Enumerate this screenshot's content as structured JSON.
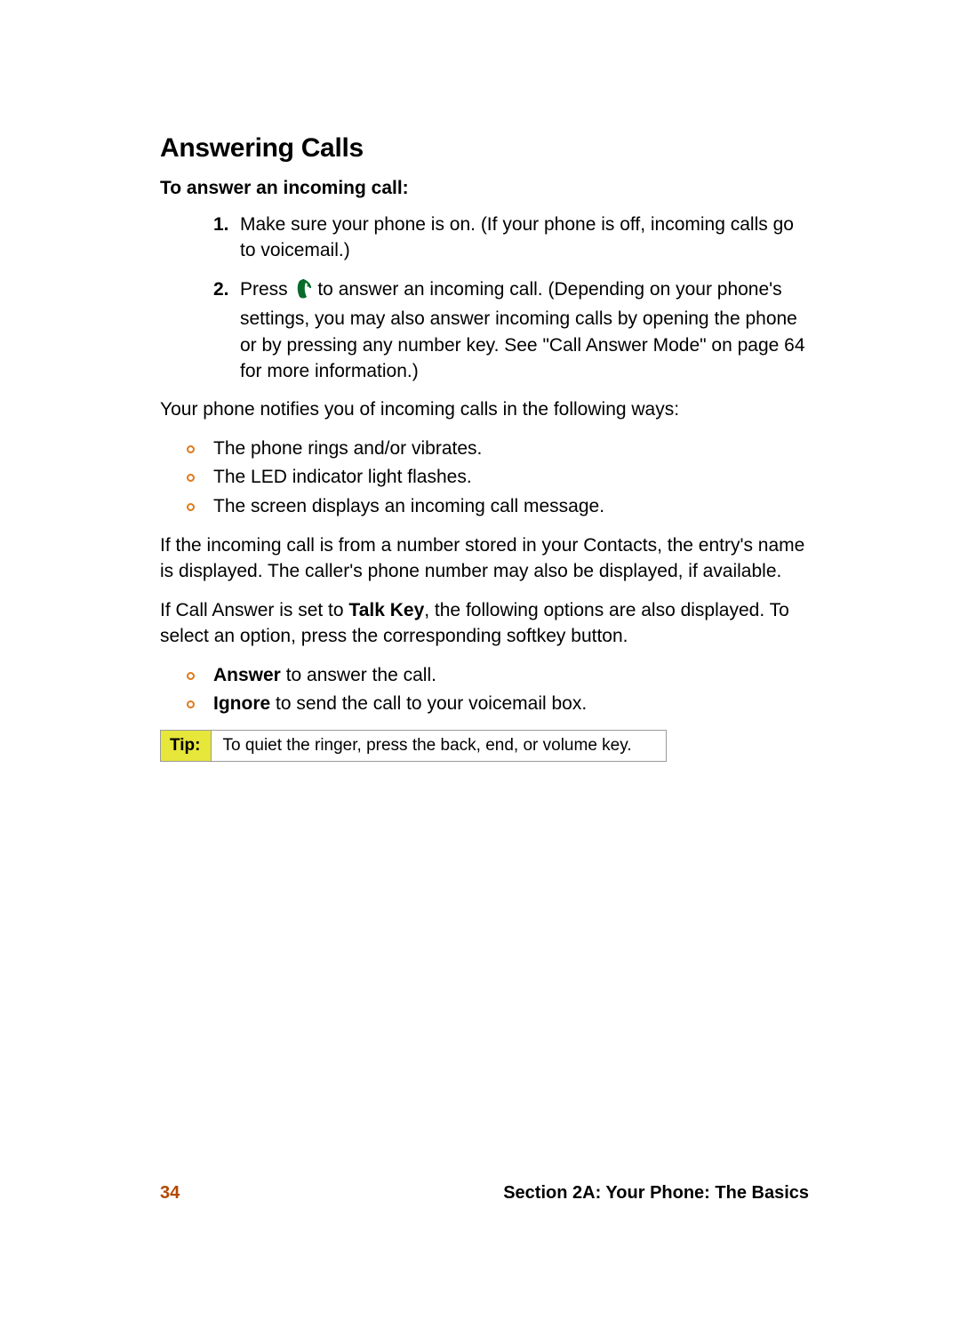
{
  "heading": "Answering Calls",
  "subheading": "To answer an incoming call:",
  "steps": [
    {
      "marker": "1.",
      "text": "Make sure your phone is on. (If your phone is off, incoming calls go to voicemail.)"
    },
    {
      "marker": "2.",
      "pre": "Press ",
      "post": " to answer an incoming call. (Depending on your phone's settings, you may also answer incoming calls by opening the phone or by pressing any number key. See \"Call Answer Mode\" on page 64 for more information.)"
    }
  ],
  "notify_intro": "Your phone notifies you of incoming calls in the following ways:",
  "notify_items": [
    "The phone rings and/or vibrates.",
    "The LED indicator light flashes.",
    "The screen displays an incoming call message."
  ],
  "contacts_para": "If the incoming call is from a number stored in your Contacts, the entry's name is displayed. The caller's phone number may also be displayed, if available.",
  "talkkey_para_pre": "If Call Answer is set to ",
  "talkkey_bold": "Talk Key",
  "talkkey_para_post": ", the following options are also displayed. To select an option, press the corresponding softkey button.",
  "option_items": [
    {
      "bold": "Answer",
      "rest": " to answer the call."
    },
    {
      "bold": "Ignore",
      "rest": " to send the call to your voicemail box."
    }
  ],
  "tip": {
    "label": "Tip:",
    "text": "To quiet the ringer, press the back, end, or volume key."
  },
  "footer": {
    "page_number": "34",
    "section": "Section 2A: Your Phone: The Basics"
  },
  "icon_name": "talk-key-icon",
  "colors": {
    "accent_orange": "#DE7A1B",
    "page_num": "#B34700",
    "tip_bg": "#e6e63b"
  }
}
